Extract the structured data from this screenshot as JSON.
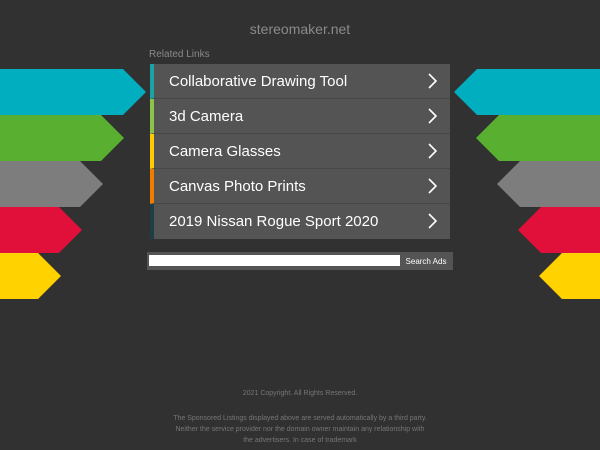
{
  "site": {
    "title": "stereomaker.net"
  },
  "related": {
    "heading": "Related Links",
    "items": [
      {
        "label": "Collaborative Drawing Tool",
        "accent": "#19a3a6"
      },
      {
        "label": "3d Camera",
        "accent": "#8bc34a"
      },
      {
        "label": "Camera Glasses",
        "accent": "#ffcb05"
      },
      {
        "label": "Canvas Photo Prints",
        "accent": "#ef7d00"
      },
      {
        "label": "2019 Nissan Rogue Sport 2020",
        "accent": "#1f3d44"
      }
    ]
  },
  "search": {
    "input_value": "",
    "button_label": "Search Ads"
  },
  "footer": {
    "copyright": "2021 Copyright. All Rights Reserved.",
    "disclaimer": "The Sponsored Listings displayed above are served automatically by a third party. Neither the service provider nor the domain owner maintain any relationship with the advertisers. In case of trademark"
  },
  "colors": {
    "background": "#313131",
    "panel": "#545454",
    "arrow_teal": "#00aec0",
    "arrow_green": "#59b030",
    "arrow_gray": "#7d7d7d",
    "arrow_red": "#e0103a",
    "arrow_yellow": "#ffd200"
  }
}
